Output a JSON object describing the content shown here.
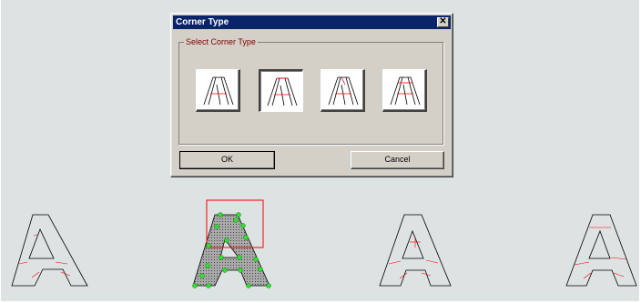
{
  "dialog": {
    "title": "Corner Type",
    "close_glyph": "✕",
    "group_label": "Select Corner Type",
    "corner_types": [
      {
        "name": "corner-type-1",
        "selected": false
      },
      {
        "name": "corner-type-2",
        "selected": true
      },
      {
        "name": "corner-type-3",
        "selected": false
      },
      {
        "name": "corner-type-4",
        "selected": false
      }
    ],
    "ok_label": "OK",
    "cancel_label": "Cancel"
  },
  "colors": {
    "canvas_bg": "#dde2e2",
    "titlebar": "#0a246a",
    "group_label": "#800000",
    "outline_stroke": "#000000",
    "guide_stroke": "#ff0000",
    "node_fill": "#33dd33",
    "glyph_fill": "#808080"
  },
  "icons": [
    "close-icon",
    "letter-a-glyph"
  ]
}
